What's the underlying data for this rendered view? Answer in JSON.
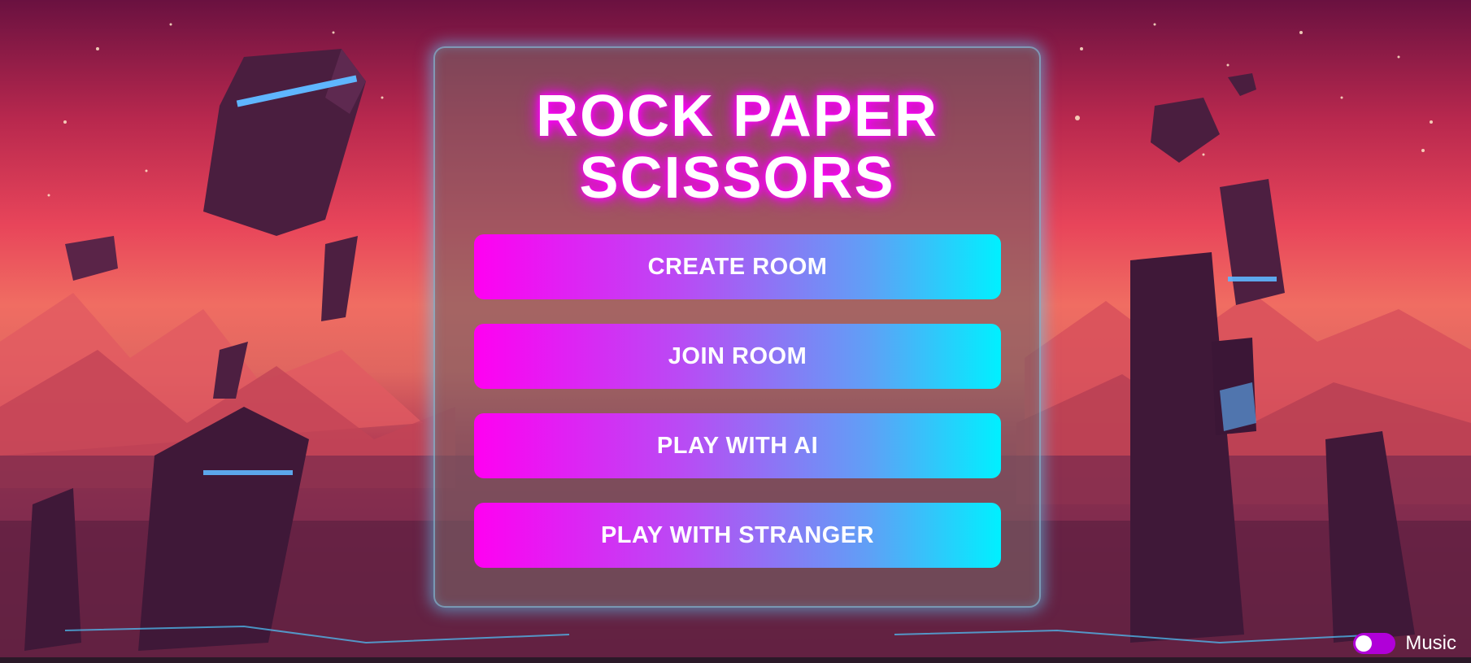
{
  "game": {
    "title_line1": "ROCK PAPER",
    "title_line2": "SCISSORS"
  },
  "menu": {
    "create_room": "CREATE ROOM",
    "join_room": "JOIN ROOM",
    "play_ai": "PLAY WITH AI",
    "play_stranger": "PLAY WITH STRANGER"
  },
  "music": {
    "label": "Music",
    "enabled": true
  },
  "colors": {
    "title_glow": "#ff00ff",
    "button_gradient_start": "#ff00f2",
    "button_gradient_end": "#00f0ff",
    "panel_border": "#82dcff"
  }
}
